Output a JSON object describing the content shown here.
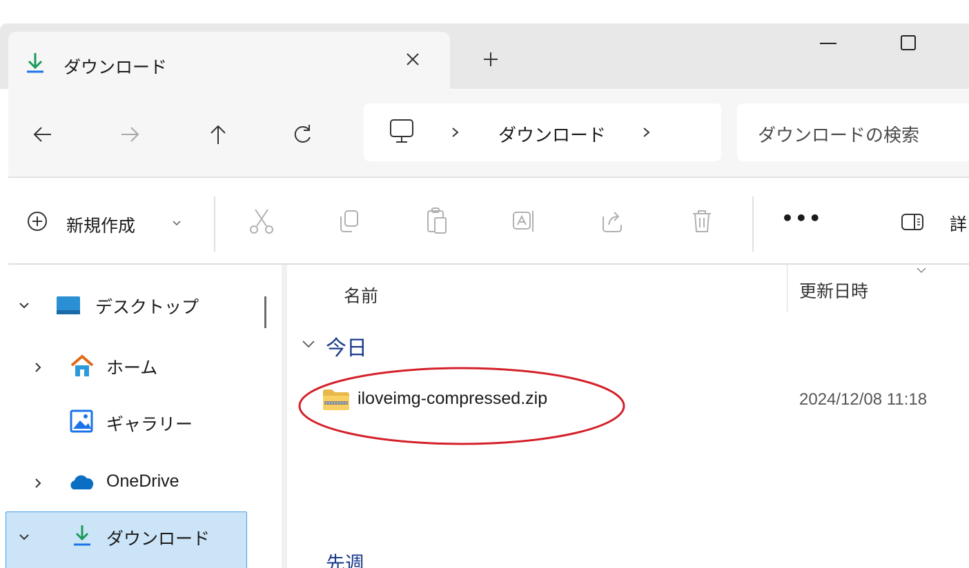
{
  "tab": {
    "title": "ダウンロード"
  },
  "address": {
    "location": "ダウンロード"
  },
  "search": {
    "placeholder": "ダウンロードの検索"
  },
  "toolbar": {
    "new_label": "新規作成",
    "more_label": "•••",
    "details_label": "詳"
  },
  "sidebar": {
    "items": [
      {
        "label": "デスクトップ",
        "icon": "desktop-icon",
        "expanded": true
      },
      {
        "label": "ホーム",
        "icon": "home-icon",
        "expanded": false
      },
      {
        "label": "ギャラリー",
        "icon": "gallery-icon"
      },
      {
        "label": "OneDrive",
        "icon": "onedrive-icon",
        "expanded": false
      },
      {
        "label": "ダウンロード",
        "icon": "download-icon",
        "expanded": true,
        "selected": true
      }
    ]
  },
  "columns": {
    "name": "名前",
    "modified": "更新日時"
  },
  "groups": [
    {
      "title": "今日",
      "files": [
        {
          "name": "iloveimg-compressed.zip",
          "modified": "2024/12/08 11:18",
          "icon": "zip-folder-icon",
          "highlighted": true
        }
      ]
    },
    {
      "title": "先週"
    }
  ],
  "colors": {
    "accent": "#1a73e8",
    "selected_bg": "#cce4f7",
    "highlight_ring": "#d4202a",
    "download_green": "#1b9a5a"
  }
}
